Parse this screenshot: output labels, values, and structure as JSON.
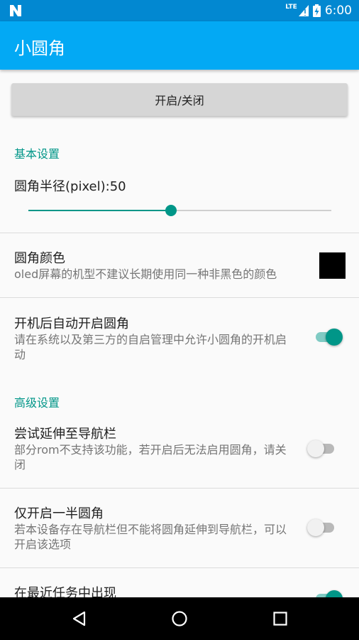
{
  "status_bar": {
    "network": "LTE",
    "battery_icon": "battery-charging-icon",
    "time": "6:00"
  },
  "app_bar": {
    "title": "小圆角"
  },
  "toggle_button": {
    "label": "开启/关闭"
  },
  "basic_settings": {
    "header": "基本设置",
    "radius": {
      "label": "圆角半径(pixel):50",
      "value": 50,
      "fraction": 0.47
    },
    "corner_color": {
      "title": "圆角颜色",
      "summary": "oled屏幕的机型不建议长期使用同一种非黑色的颜色",
      "color": "#000000"
    },
    "autostart": {
      "title": "开机后自动开启圆角",
      "summary": "请在系统以及第三方的自启管理中允许小圆角的开机启动",
      "enabled": true
    }
  },
  "advanced_settings": {
    "header": "高级设置",
    "extend_nav": {
      "title": "尝试延伸至导航栏",
      "summary": "部分rom不支持该功能，若开启后无法启用圆角，请关闭",
      "enabled": false
    },
    "half_corners": {
      "title": "仅开启一半圆角",
      "summary": "若本设备存在导航栏但不能将圆角延伸到导航栏，可以开启该选项",
      "enabled": false
    },
    "recents": {
      "title": "在最近任务中出现",
      "enabled": true
    }
  },
  "colors": {
    "accent": "#009688",
    "primary": "#03a9f4",
    "primary_dark": "#0288d1"
  },
  "nav_bar": {
    "back_icon": "back-triangle-icon",
    "home_icon": "home-circle-icon",
    "recents_icon": "recents-square-icon"
  }
}
